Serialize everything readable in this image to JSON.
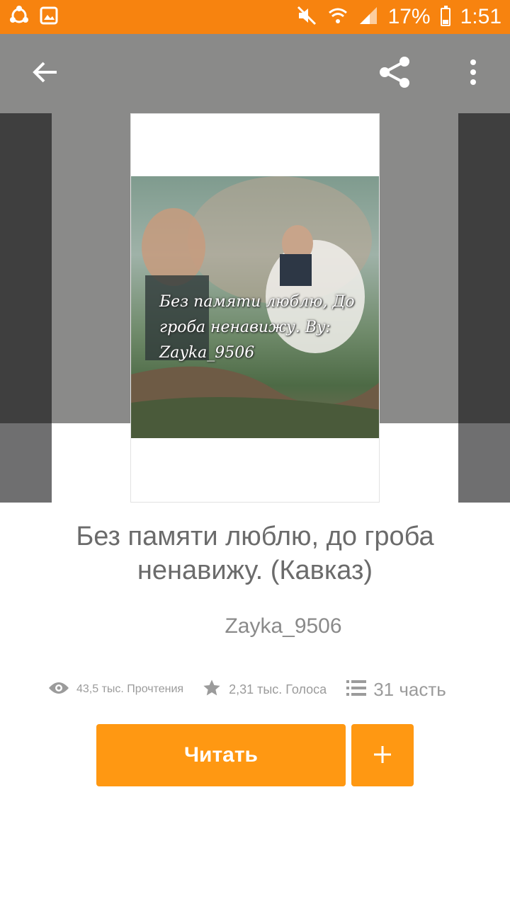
{
  "status_bar": {
    "battery": "17%",
    "time": "1:51",
    "icons": [
      "sync-icon",
      "image-icon",
      "mute-icon",
      "wifi-icon",
      "signal-icon",
      "battery-icon"
    ]
  },
  "toolbar": {
    "back_icon": "arrow-left-icon",
    "share_icon": "share-icon",
    "more_icon": "more-vertical-icon"
  },
  "book": {
    "cover_text": "Без памяти люблю, До гроба ненавижу. By: Zayka_9506",
    "title": "Без памяти люблю, до гроба ненавижу.  (Кавказ)",
    "author": "Zayka_9506",
    "reads": "43,5 тыс. Прочтения",
    "votes": "2,31 тыс. Голоса",
    "parts": "31 часть"
  },
  "actions": {
    "read_label": "Читать",
    "add_icon": "plus-icon"
  },
  "colors": {
    "status_bar": "#f7830f",
    "header": "#8a8a89",
    "accent": "#ff9812",
    "text_gray": "#6b6b6b"
  }
}
